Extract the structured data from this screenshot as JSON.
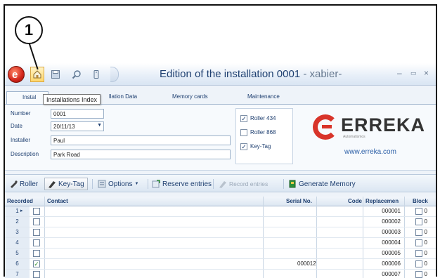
{
  "callout": {
    "number": "1"
  },
  "window": {
    "title": "Edition of the installation 0001",
    "title_suffix": " - xabier-",
    "min_label": "–",
    "max_label": "▭",
    "close_label": "×"
  },
  "quick_access": {
    "icons": [
      "logo-orb-icon",
      "installations-index-icon",
      "save-icon",
      "search-icon",
      "device-icon"
    ]
  },
  "tabs": [
    {
      "label": "Instal"
    },
    {
      "label": "llation Data"
    },
    {
      "label": "Memory cards"
    },
    {
      "label": "Maintenance"
    }
  ],
  "tooltip": "Installations Index",
  "form": {
    "number_label": "Number",
    "number_value": "0001",
    "date_label": "Date",
    "date_value": "20/11/13",
    "installer_label": "Installer",
    "installer_value": "Paul",
    "description_label": "Description",
    "description_value": "Park Road"
  },
  "options": [
    {
      "label": "Roller 434",
      "checked": true
    },
    {
      "label": "Roller 868",
      "checked": false
    },
    {
      "label": "Key-Tag",
      "checked": true
    }
  ],
  "brand": {
    "name": "ERREKA",
    "tagline": "Automatismos",
    "url": "www.erreka.com",
    "color": "#d8342a"
  },
  "toolbar": {
    "roller": "Roller",
    "keytag": "Key-Tag",
    "options": "Options",
    "reserve": "Reserve entries",
    "record": "Record entries",
    "generate": "Generate Memory"
  },
  "grid": {
    "headers": {
      "recorded": "Recorded",
      "contact": "Contact",
      "serial": "Serial No.",
      "code": "Code",
      "replacement": "Replacemen",
      "block": "Block"
    },
    "rows": [
      {
        "n": "1",
        "recorded": false,
        "contact": "",
        "serial": "",
        "code": "000001",
        "replacement": "0"
      },
      {
        "n": "2",
        "recorded": false,
        "contact": "",
        "serial": "",
        "code": "000002",
        "replacement": "0"
      },
      {
        "n": "3",
        "recorded": false,
        "contact": "",
        "serial": "",
        "code": "000003",
        "replacement": "0"
      },
      {
        "n": "4",
        "recorded": false,
        "contact": "",
        "serial": "",
        "code": "000004",
        "replacement": "0"
      },
      {
        "n": "5",
        "recorded": false,
        "contact": "",
        "serial": "",
        "code": "000005",
        "replacement": "0"
      },
      {
        "n": "6",
        "recorded": true,
        "contact": "",
        "serial": "000012",
        "code": "000006",
        "replacement": "0"
      },
      {
        "n": "7",
        "recorded": false,
        "contact": "",
        "serial": "",
        "code": "000007",
        "replacement": "0"
      }
    ]
  }
}
